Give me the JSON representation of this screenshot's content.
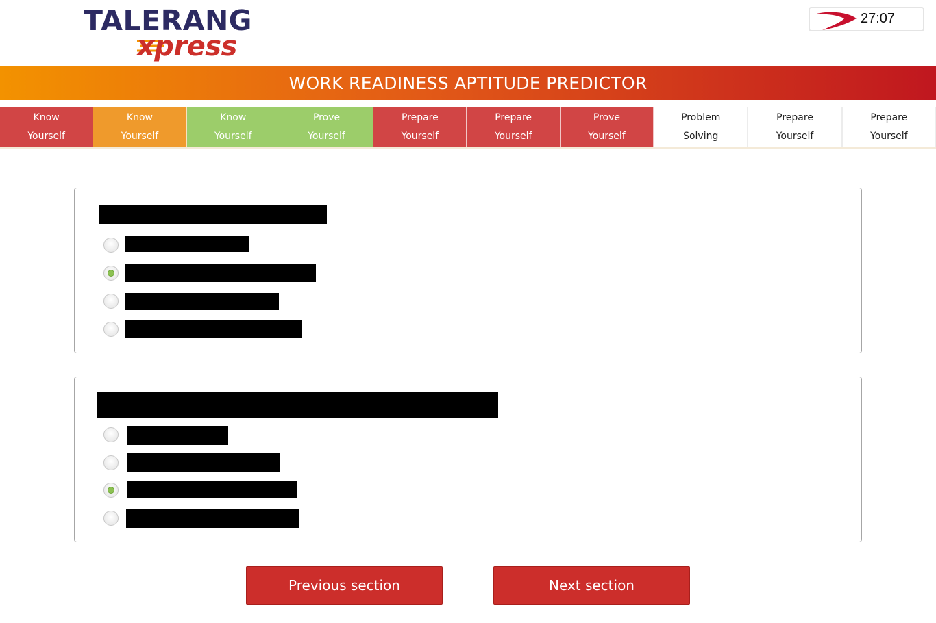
{
  "brand": {
    "name_top": "TALERANG",
    "name_bottom": "xpress",
    "colors": {
      "navy": "#2c2a62",
      "red": "#cc2f2a",
      "orange": "#f39200"
    }
  },
  "timer": {
    "value": "27:07",
    "icon": "swoosh-logo-icon"
  },
  "banner": {
    "title": "WORK READINESS APTITUDE PREDICTOR"
  },
  "steps": [
    {
      "line1": "Know",
      "line2": "Yourself",
      "status": "red"
    },
    {
      "line1": "Know",
      "line2": "Yourself",
      "status": "orange"
    },
    {
      "line1": "Know",
      "line2": "Yourself",
      "status": "green"
    },
    {
      "line1": "Prove",
      "line2": "Yourself",
      "status": "green"
    },
    {
      "line1": "Prepare",
      "line2": "Yourself",
      "status": "red"
    },
    {
      "line1": "Prepare",
      "line2": "Yourself",
      "status": "red"
    },
    {
      "line1": "Prove",
      "line2": "Yourself",
      "status": "red"
    },
    {
      "line1": "Problem",
      "line2": "Solving",
      "status": "white"
    },
    {
      "line1": "Prepare",
      "line2": "Yourself",
      "status": "white"
    },
    {
      "line1": "Prepare",
      "line2": "Yourself",
      "status": "white"
    }
  ],
  "questions": [
    {
      "text": "",
      "selected_index": 1,
      "options": [
        "",
        "",
        "",
        ""
      ]
    },
    {
      "text": "",
      "selected_index": 2,
      "options": [
        "",
        "",
        "",
        ""
      ]
    }
  ],
  "buttons": {
    "previous_label": "Previous section",
    "next_label": "Next section"
  }
}
